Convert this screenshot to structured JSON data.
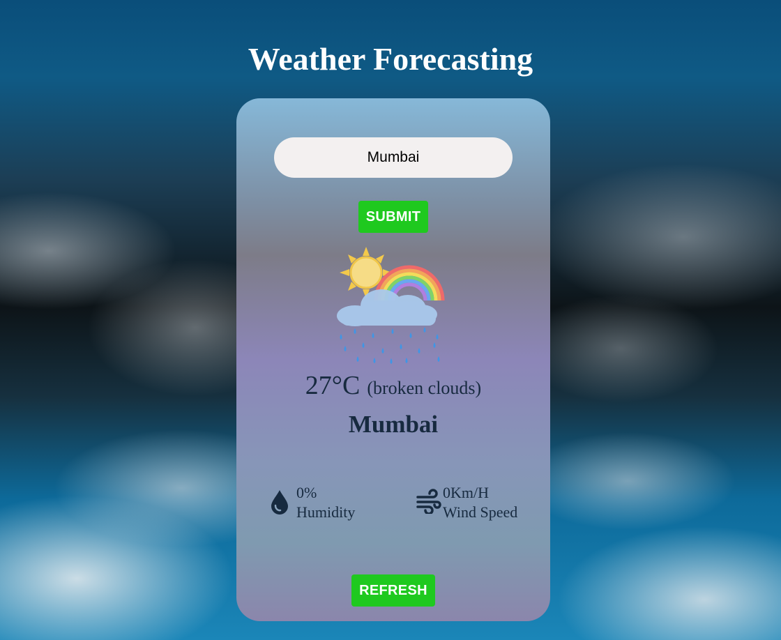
{
  "app": {
    "title": "Weather Forecasting"
  },
  "search": {
    "value": "Mumbai"
  },
  "buttons": {
    "submit_label": "SUBMIT",
    "refresh_label": "REFRESH"
  },
  "weather": {
    "icon": "sun-rainbow-rain-cloud-icon",
    "temperature": "27°C",
    "description": "(broken clouds)",
    "city": "Mumbai",
    "humidity": {
      "value": "0%",
      "label": "Humidity",
      "icon": "water-drop-icon"
    },
    "wind": {
      "value": "0Km/H",
      "label": "Wind Speed",
      "icon": "wind-icon"
    }
  },
  "colors": {
    "button": "#1fc91f",
    "text_dark": "#172a3f",
    "title": "#ffffff",
    "input_bg": "#f3f0f0"
  }
}
